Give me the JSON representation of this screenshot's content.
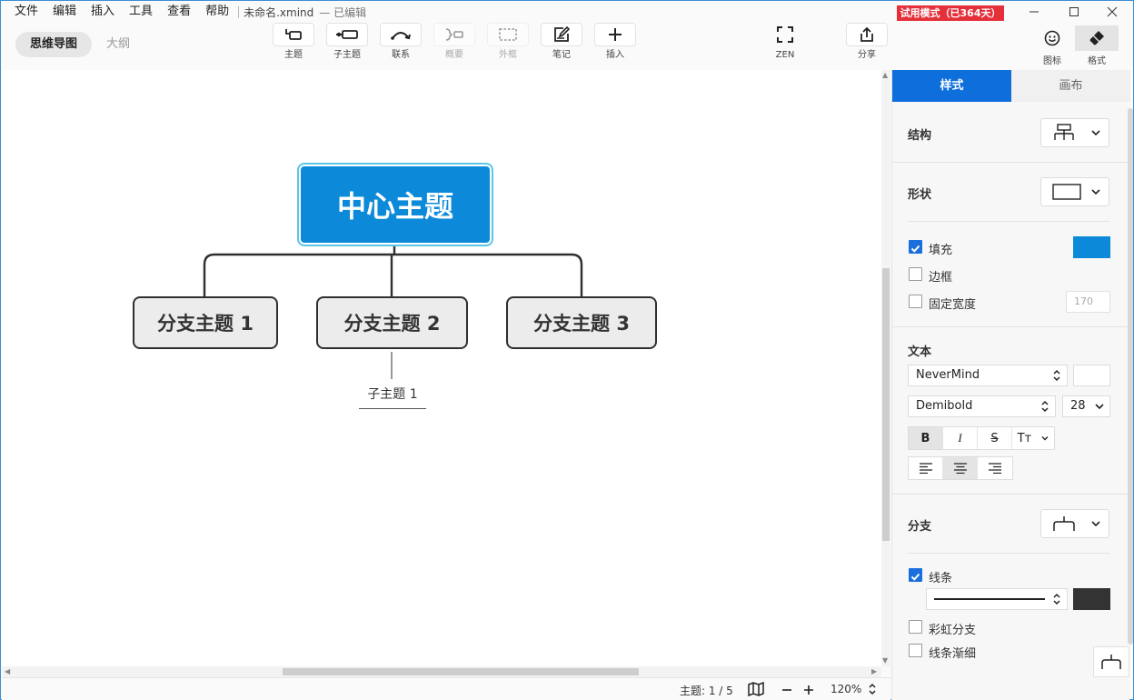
{
  "menu": {
    "items": [
      "文件",
      "编辑",
      "插入",
      "工具",
      "查看",
      "帮助"
    ],
    "doc_title": "未命名.xmind",
    "doc_status": "— 已编辑"
  },
  "mode": {
    "mindmap": "思维导图",
    "outline": "大纲"
  },
  "toolbar": {
    "topic": "主题",
    "subtopic": "子主题",
    "relation": "联系",
    "summary": "概要",
    "boundary": "外框",
    "note": "笔记",
    "insert": "插入",
    "zen": "ZEN",
    "share": "分享"
  },
  "trial": "试用模式（已364天）",
  "panel_toggles": {
    "icons": "图标",
    "format": "格式"
  },
  "map": {
    "central": "中心主题",
    "branches": [
      "分支主题 1",
      "分支主题 2",
      "分支主题 3"
    ],
    "subtopic": "子主题 1"
  },
  "status": {
    "topic_count": "主题: 1 / 5",
    "zoom": "120%"
  },
  "panel": {
    "tabs": {
      "style": "样式",
      "canvas": "画布"
    },
    "structure": "结构",
    "shape": "形状",
    "fill": "填充",
    "fill_checked": true,
    "fill_color": "#0c8ad9",
    "border": "边框",
    "border_checked": false,
    "fixed_width": "固定宽度",
    "fixed_width_checked": false,
    "fixed_width_value": "170",
    "text": "文本",
    "font_family": "NeverMind",
    "font_weight": "Demibold",
    "font_size": "28",
    "text_color": "#ffffff",
    "fmt": {
      "bold": "B",
      "italic": "I",
      "strike": "S",
      "case": "Tт"
    },
    "branch": "分支",
    "line": "线条",
    "line_checked": true,
    "line_color": "#333333",
    "rainbow": "彩虹分支",
    "rainbow_checked": false,
    "taper": "线条渐细",
    "taper_checked": false
  }
}
